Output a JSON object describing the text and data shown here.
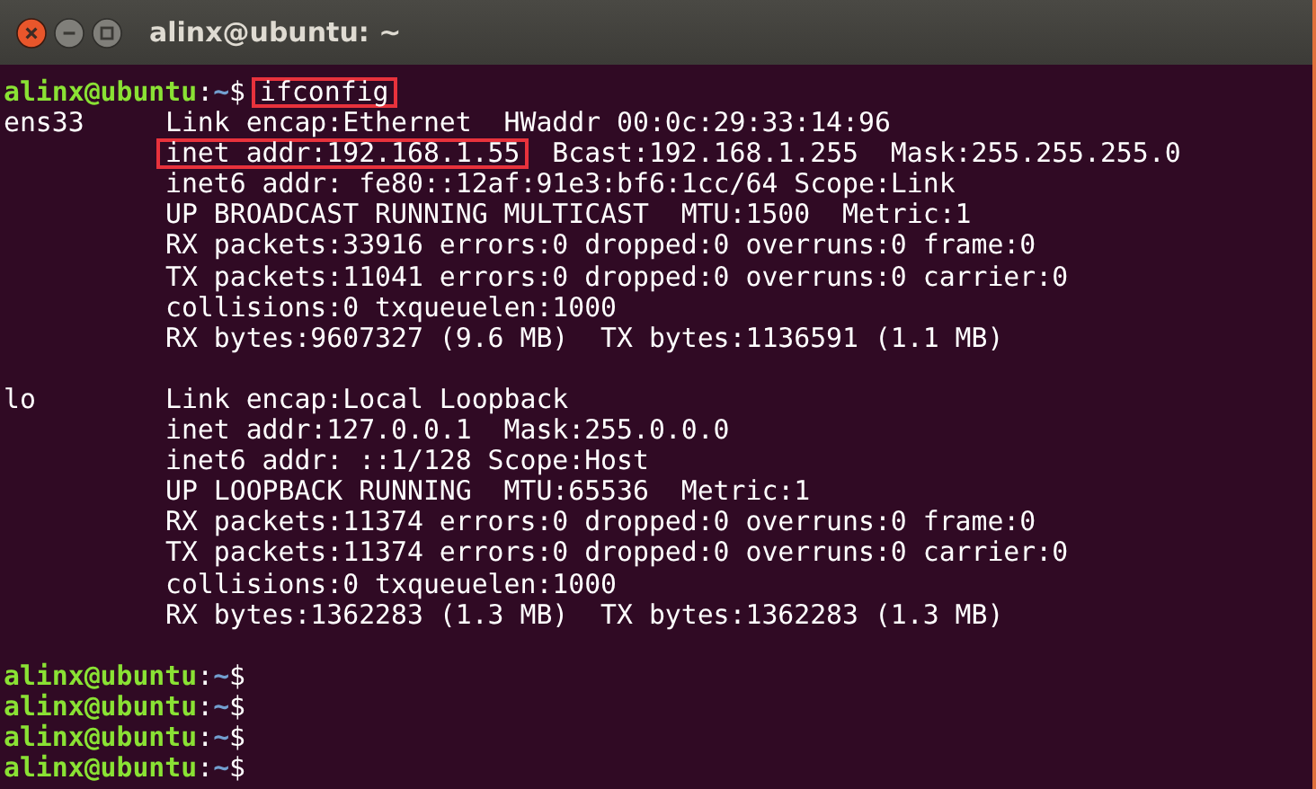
{
  "window": {
    "title": "alinx@ubuntu: ~"
  },
  "terminal": {
    "lines": [
      {
        "kind": "prompt",
        "user_host": "alinx@ubuntu",
        "separator": ":",
        "path": "~",
        "symbol": "$",
        "command": "ifconfig",
        "highlighted": true
      },
      {
        "kind": "iface",
        "name": "ens33",
        "segments": [
          {
            "text": "Link encap:Ethernet  HWaddr 00:0c:29:33:14:96",
            "highlighted": false
          }
        ]
      },
      {
        "kind": "detail",
        "segments": [
          {
            "text": "inet addr:192.168.1.55",
            "highlighted": true
          },
          {
            "text": "  Bcast:192.168.1.255  Mask:255.255.255.0",
            "highlighted": false
          }
        ]
      },
      {
        "kind": "detail",
        "segments": [
          {
            "text": "inet6 addr: fe80::12af:91e3:bf6:1cc/64 Scope:Link",
            "highlighted": false
          }
        ]
      },
      {
        "kind": "detail",
        "segments": [
          {
            "text": "UP BROADCAST RUNNING MULTICAST  MTU:1500  Metric:1",
            "highlighted": false
          }
        ]
      },
      {
        "kind": "detail",
        "segments": [
          {
            "text": "RX packets:33916 errors:0 dropped:0 overruns:0 frame:0",
            "highlighted": false
          }
        ]
      },
      {
        "kind": "detail",
        "segments": [
          {
            "text": "TX packets:11041 errors:0 dropped:0 overruns:0 carrier:0",
            "highlighted": false
          }
        ]
      },
      {
        "kind": "detail",
        "segments": [
          {
            "text": "collisions:0 txqueuelen:1000",
            "highlighted": false
          }
        ]
      },
      {
        "kind": "detail",
        "segments": [
          {
            "text": "RX bytes:9607327 (9.6 MB)  TX bytes:1136591 (1.1 MB)",
            "highlighted": false
          }
        ]
      },
      {
        "kind": "blank"
      },
      {
        "kind": "iface",
        "name": "lo",
        "segments": [
          {
            "text": "Link encap:Local Loopback",
            "highlighted": false
          }
        ]
      },
      {
        "kind": "detail",
        "segments": [
          {
            "text": "inet addr:127.0.0.1  Mask:255.0.0.0",
            "highlighted": false
          }
        ]
      },
      {
        "kind": "detail",
        "segments": [
          {
            "text": "inet6 addr: ::1/128 Scope:Host",
            "highlighted": false
          }
        ]
      },
      {
        "kind": "detail",
        "segments": [
          {
            "text": "UP LOOPBACK RUNNING  MTU:65536  Metric:1",
            "highlighted": false
          }
        ]
      },
      {
        "kind": "detail",
        "segments": [
          {
            "text": "RX packets:11374 errors:0 dropped:0 overruns:0 frame:0",
            "highlighted": false
          }
        ]
      },
      {
        "kind": "detail",
        "segments": [
          {
            "text": "TX packets:11374 errors:0 dropped:0 overruns:0 carrier:0",
            "highlighted": false
          }
        ]
      },
      {
        "kind": "detail",
        "segments": [
          {
            "text": "collisions:0 txqueuelen:1000",
            "highlighted": false
          }
        ]
      },
      {
        "kind": "detail",
        "segments": [
          {
            "text": "RX bytes:1362283 (1.3 MB)  TX bytes:1362283 (1.3 MB)",
            "highlighted": false
          }
        ]
      },
      {
        "kind": "blank"
      },
      {
        "kind": "prompt",
        "user_host": "alinx@ubuntu",
        "separator": ":",
        "path": "~",
        "symbol": "$"
      },
      {
        "kind": "prompt",
        "user_host": "alinx@ubuntu",
        "separator": ":",
        "path": "~",
        "symbol": "$"
      },
      {
        "kind": "prompt",
        "user_host": "alinx@ubuntu",
        "separator": ":",
        "path": "~",
        "symbol": "$"
      },
      {
        "kind": "prompt",
        "user_host": "alinx@ubuntu",
        "separator": ":",
        "path": "~",
        "symbol": "$"
      }
    ]
  }
}
